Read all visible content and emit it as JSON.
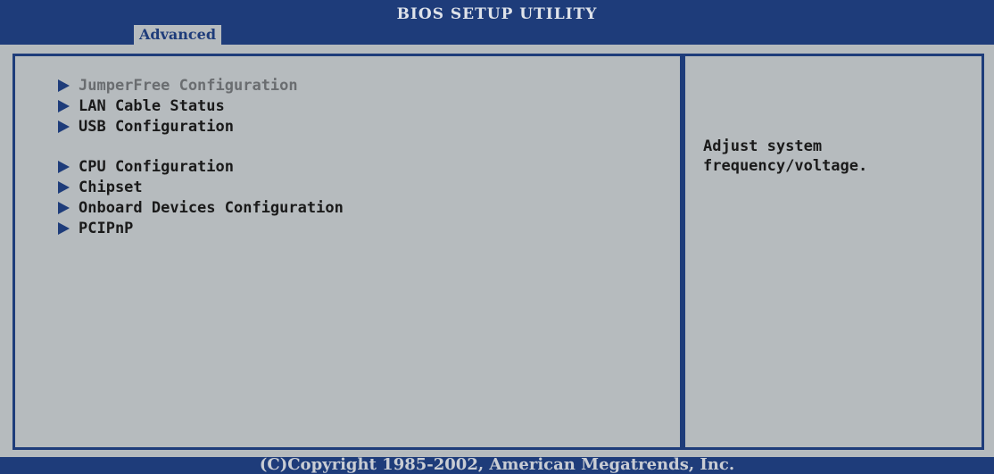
{
  "header": {
    "title": "BIOS SETUP UTILITY",
    "active_tab": "Advanced"
  },
  "menu": {
    "items": [
      {
        "label": "JumperFree Configuration",
        "selected": true
      },
      {
        "label": "LAN Cable Status"
      },
      {
        "label": "USB Configuration"
      },
      {
        "label": "CPU Configuration"
      },
      {
        "label": "Chipset"
      },
      {
        "label": "Onboard Devices Configuration"
      },
      {
        "label": "PCIPnP"
      }
    ]
  },
  "help": {
    "text": "Adjust system\nfrequency/voltage."
  },
  "footer": {
    "copyright": "(C)Copyright 1985-2002, American Megatrends, Inc."
  },
  "colors": {
    "bar": "#1e3c7a",
    "panel": "#b6bbbe",
    "selected_text": "#6a6d70"
  },
  "icons": {
    "menu_item": "submenu-arrow-icon"
  }
}
